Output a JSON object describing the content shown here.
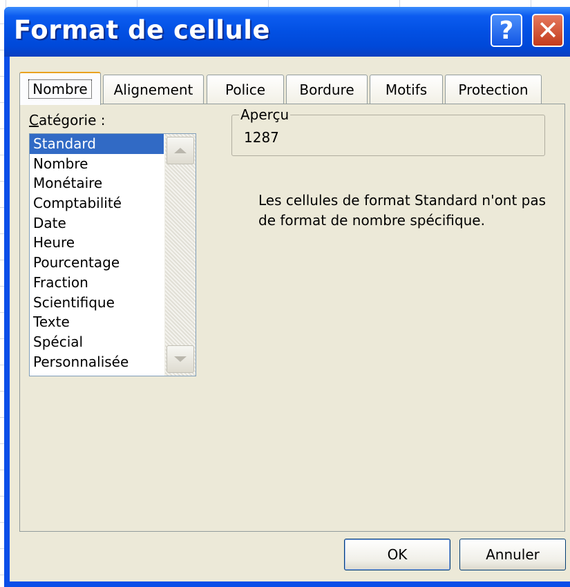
{
  "dialog": {
    "title": "Format de cellule",
    "help_glyph": "?",
    "close_glyph": "✕"
  },
  "tabs": [
    {
      "label": "Nombre",
      "active": true
    },
    {
      "label": "Alignement",
      "active": false
    },
    {
      "label": "Police",
      "active": false
    },
    {
      "label": "Bordure",
      "active": false
    },
    {
      "label": "Motifs",
      "active": false
    },
    {
      "label": "Protection",
      "active": false
    }
  ],
  "category": {
    "label_mnemonic": "C",
    "label_rest": "atégorie :",
    "items": [
      "Standard",
      "Nombre",
      "Monétaire",
      "Comptabilité",
      "Date",
      "Heure",
      "Pourcentage",
      "Fraction",
      "Scientifique",
      "Texte",
      "Spécial",
      "Personnalisée"
    ],
    "selected": "Standard"
  },
  "preview": {
    "legend": "Aperçu",
    "value": "1287"
  },
  "description": "Les cellules de format Standard n'ont pas de format de nombre spécifique.",
  "buttons": {
    "ok": "OK",
    "cancel": "Annuler"
  },
  "colors": {
    "titlebar": "#0250e3",
    "selection": "#316ac5",
    "dialog_bg": "#ece9d8",
    "close_button": "#c23b1c"
  }
}
